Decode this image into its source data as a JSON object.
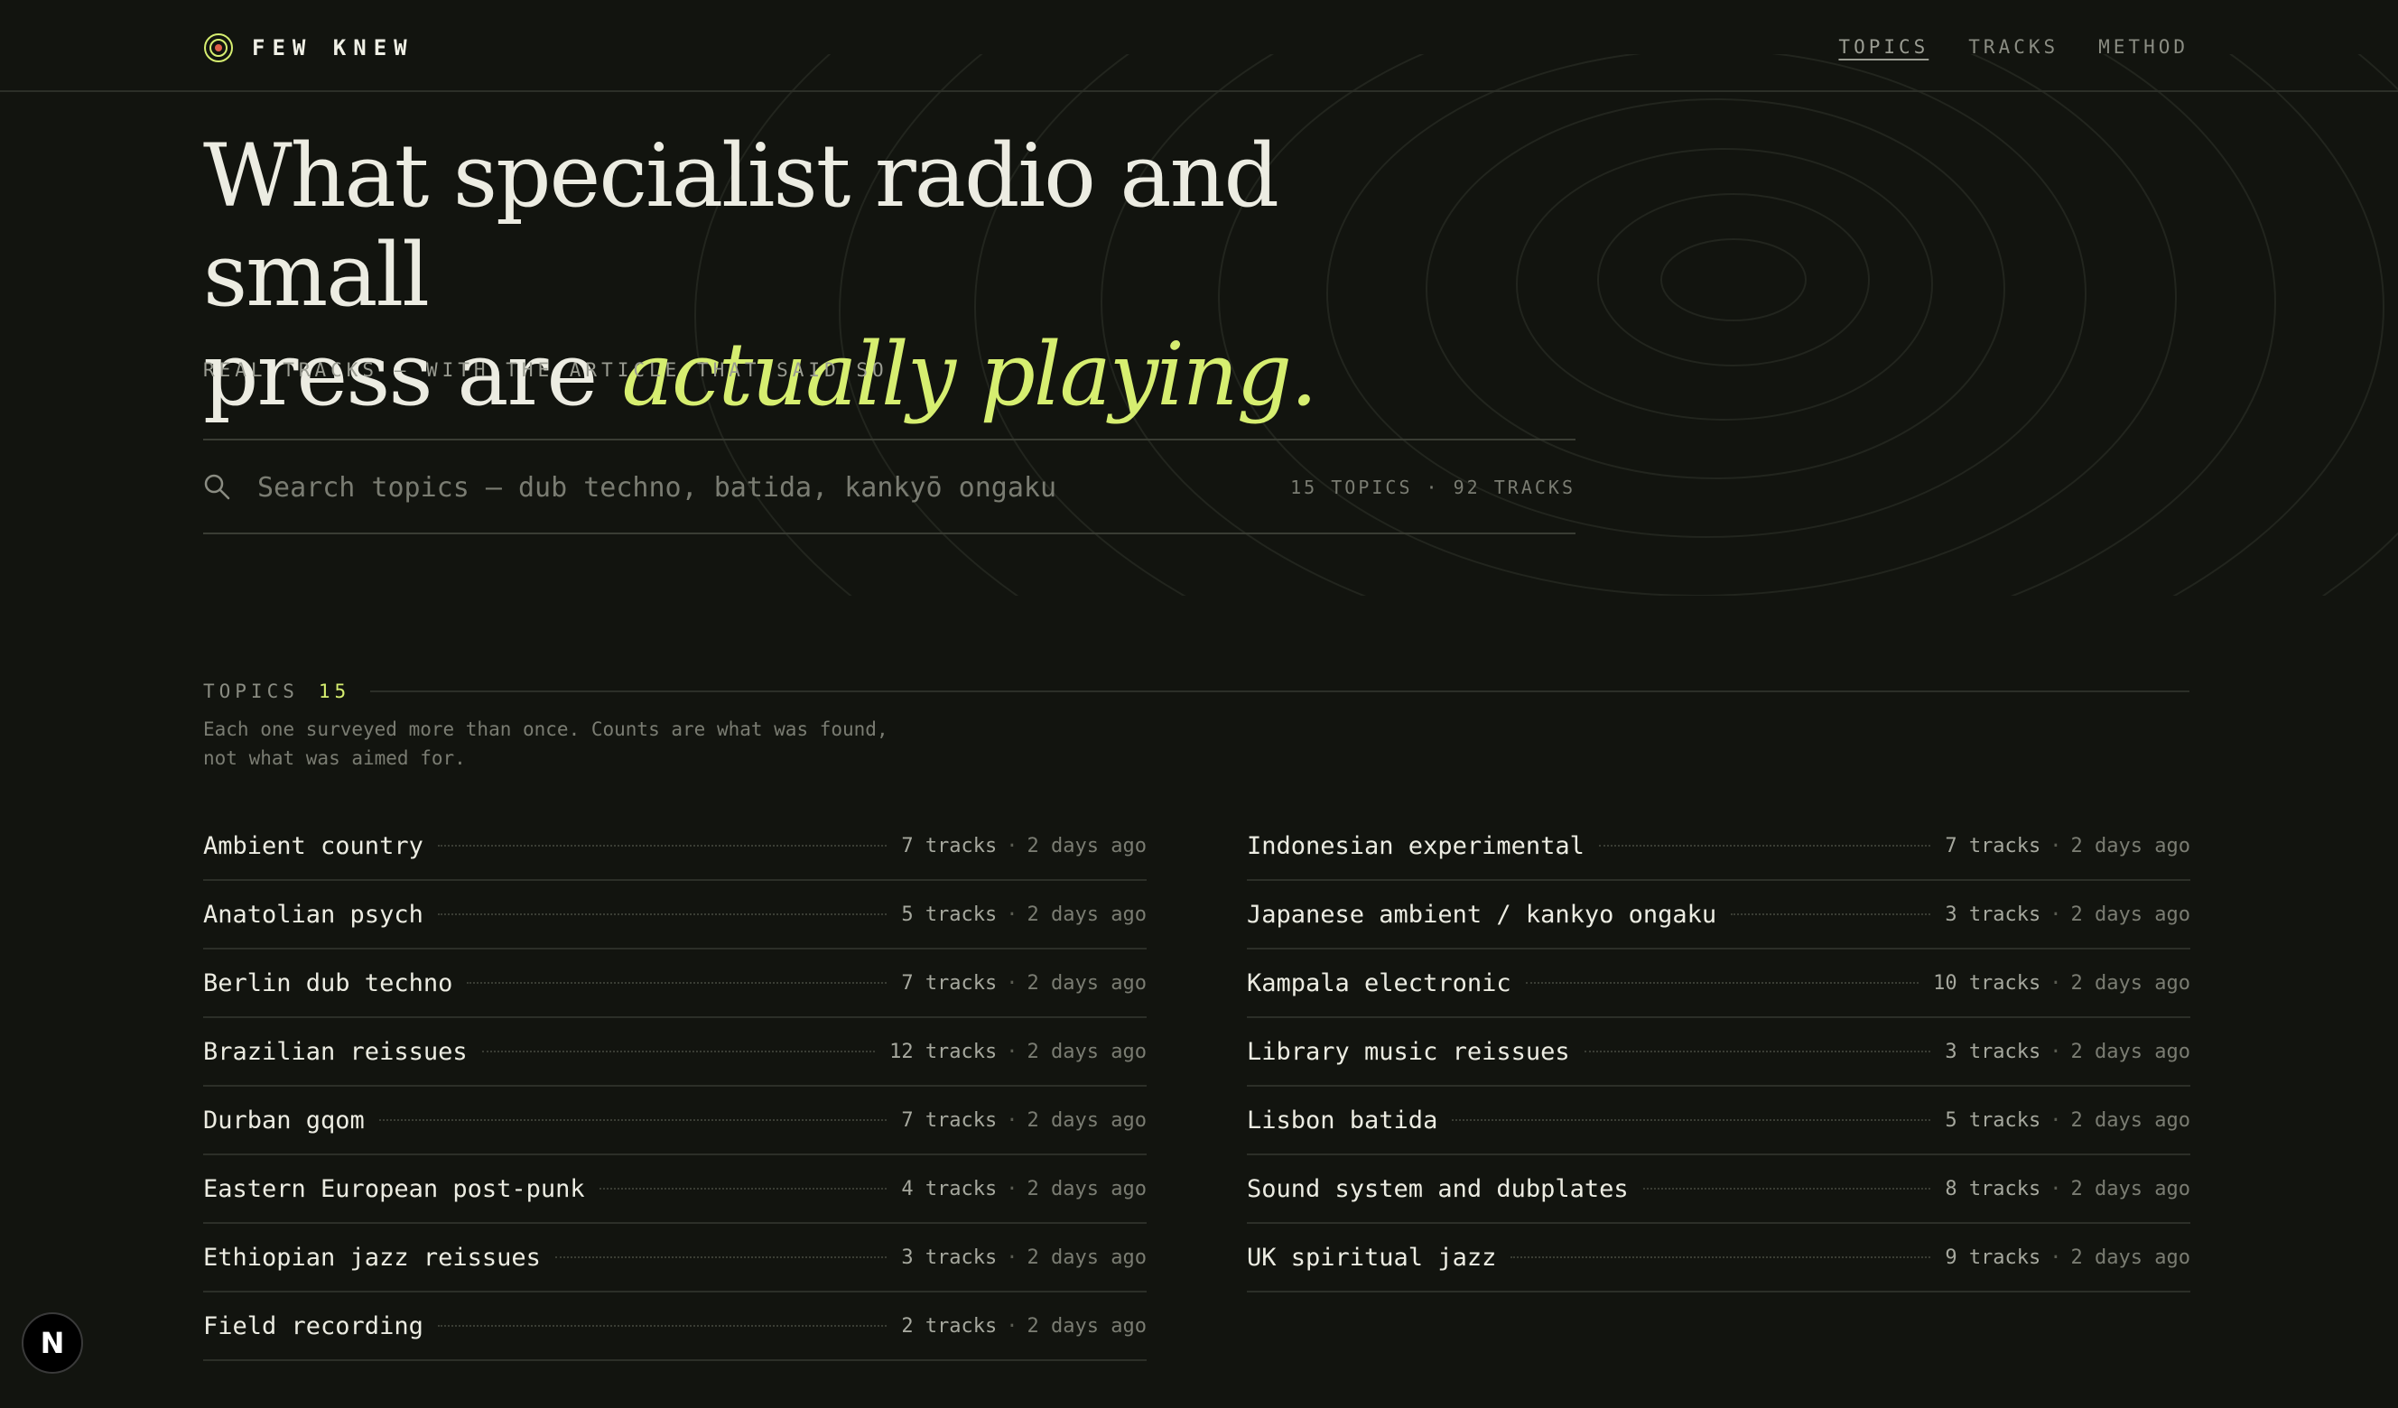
{
  "brand": {
    "name": "FEW KNEW",
    "logo_icon": "radio-target-icon"
  },
  "nav": [
    {
      "label": "TOPICS",
      "active": true
    },
    {
      "label": "TRACKS",
      "active": false
    },
    {
      "label": "METHOD",
      "active": false
    }
  ],
  "hero": {
    "title_line1": "What specialist radio and small",
    "title_line2_plain": "press are ",
    "title_line2_accent": "actually playing.",
    "subtitle": "REAL TRACKS — WITH THE ARTICLE THAT SAID SO"
  },
  "search": {
    "placeholder": "Search topics — dub techno, batida, kankyō ongaku",
    "value": "",
    "count_summary": "15 TOPICS · 92 TRACKS"
  },
  "topics": {
    "label": "TOPICS",
    "count": "15",
    "description": "Each one surveyed more than once. Counts are what was found, not what was aimed for.",
    "left": [
      {
        "name": "Ambient country",
        "count": "7 tracks",
        "time": "2 days ago"
      },
      {
        "name": "Anatolian psych",
        "count": "5 tracks",
        "time": "2 days ago"
      },
      {
        "name": "Berlin dub techno",
        "count": "7 tracks",
        "time": "2 days ago"
      },
      {
        "name": "Brazilian reissues",
        "count": "12 tracks",
        "time": "2 days ago"
      },
      {
        "name": "Durban gqom",
        "count": "7 tracks",
        "time": "2 days ago"
      },
      {
        "name": "Eastern European post-punk",
        "count": "4 tracks",
        "time": "2 days ago"
      },
      {
        "name": "Ethiopian jazz reissues",
        "count": "3 tracks",
        "time": "2 days ago"
      },
      {
        "name": "Field recording",
        "count": "2 tracks",
        "time": "2 days ago"
      }
    ],
    "right": [
      {
        "name": "Indonesian experimental",
        "count": "7 tracks",
        "time": "2 days ago"
      },
      {
        "name": "Japanese ambient / kankyo ongaku",
        "count": "3 tracks",
        "time": "2 days ago"
      },
      {
        "name": "Kampala electronic",
        "count": "10 tracks",
        "time": "2 days ago"
      },
      {
        "name": "Library music reissues",
        "count": "3 tracks",
        "time": "2 days ago"
      },
      {
        "name": "Lisbon batida",
        "count": "5 tracks",
        "time": "2 days ago"
      },
      {
        "name": "Sound system and dubplates",
        "count": "8 tracks",
        "time": "2 days ago"
      },
      {
        "name": "UK spiritual jazz",
        "count": "9 tracks",
        "time": "2 days ago"
      }
    ],
    "separator": "·"
  },
  "fab": {
    "label": "N",
    "icon": "nextjs-icon"
  },
  "colors": {
    "accent": "#d6ee70",
    "background": "#12140f",
    "text": "#ecece2",
    "muted": "#7a7c72"
  }
}
